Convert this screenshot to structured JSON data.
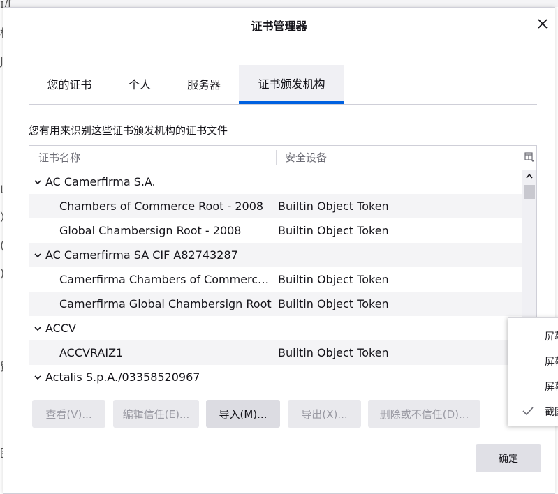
{
  "background": {
    "fragments": [
      "ɪ/[",
      "标",
      "J.",
      "L",
      "）",
      "(",
      ")",
      "贸",
      "图"
    ]
  },
  "dialog": {
    "title": "证书管理器",
    "close_icon": "close-icon"
  },
  "tabs": [
    {
      "label": "您的证书",
      "selected": false
    },
    {
      "label": "个人",
      "selected": false
    },
    {
      "label": "服务器",
      "selected": false
    },
    {
      "label": "证书颁发机构",
      "selected": true
    }
  ],
  "description": "您有用来识别这些证书颁发机构的证书文件",
  "tree": {
    "columns": [
      "证书名称",
      "安全设备"
    ],
    "rows": [
      {
        "name": "AC Camerfirma S.A.",
        "device": "",
        "group": true
      },
      {
        "name": "Chambers of Commerce Root - 2008",
        "device": "Builtin Object Token",
        "group": false
      },
      {
        "name": "Global Chambersign Root - 2008",
        "device": "Builtin Object Token",
        "group": false
      },
      {
        "name": "AC Camerfirma SA CIF A82743287",
        "device": "",
        "group": true
      },
      {
        "name": "Camerfirma Chambers of Commerce…",
        "device": "Builtin Object Token",
        "group": false
      },
      {
        "name": "Camerfirma Global Chambersign Root",
        "device": "Builtin Object Token",
        "group": false
      },
      {
        "name": "ACCV",
        "device": "",
        "group": true
      },
      {
        "name": "ACCVRAIZ1",
        "device": "Builtin Object Token",
        "group": false
      },
      {
        "name": "Actalis S.p.A./03358520967",
        "device": "",
        "group": true
      }
    ]
  },
  "buttons": {
    "view": "查看(V)...",
    "edit_trust": "编辑信任(E)...",
    "import": "导入(M)...",
    "export": "导出(X)...",
    "delete": "删除或不信任(D)...",
    "ok": "确定"
  },
  "context_menu": {
    "items": [
      "屏幕",
      "屏幕",
      "屏幕",
      "截图"
    ],
    "checked_index": 3
  },
  "colors": {
    "accent": "#0061e0",
    "selected_tab_bg": "#f0f0f4",
    "alt_row": "#f4f4f6"
  }
}
